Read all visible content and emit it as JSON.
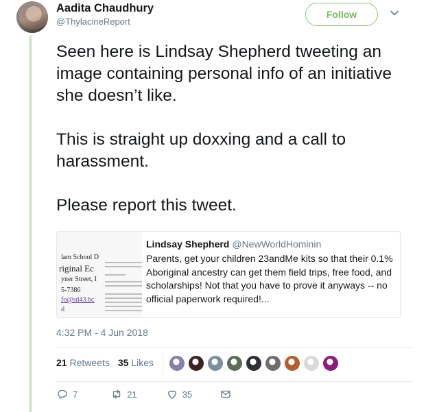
{
  "author": {
    "name": "Aadita Chaudhury",
    "handle": "@ThylacineReport"
  },
  "follow_label": "Follow",
  "tweet": {
    "paragraphs": [
      "Seen here is Lindsay Shepherd tweeting an image containing personal info of an initiative she doesn’t like.",
      "This is  straight up doxxing and a call to harassment.",
      "Please report this tweet."
    ]
  },
  "quoted": {
    "name": "Lindsay Shepherd",
    "handle": "@NewWorldHominin",
    "text": "Parents, get your children 23andMe kits so that their 0.1% Aboriginal ancestry can get them field trips, free food, and scholarships! Not that you have to prove it anyways -- no official paperwork required!...",
    "thumb_lines": [
      "lam School D",
      "riginal Ec",
      "yner Street, I",
      "5-7386",
      "fo@sd43.bc",
      "d"
    ]
  },
  "timestamp": "4:32 PM - 4 Jun 2018",
  "stats": {
    "retweets_count": "21",
    "retweets_label": "Retweets",
    "likes_count": "35",
    "likes_label": "Likes"
  },
  "liker_colors": [
    "#8a7fa8",
    "#3a2320",
    "#7c8f9a",
    "#5f6b5a",
    "#2f3136",
    "#6e6e6e",
    "#b0602f",
    "#d9d9d9",
    "#8d1d7a"
  ],
  "actions": {
    "replies": "7",
    "retweets": "21",
    "likes": "35"
  },
  "colors": {
    "accent_green": "#7cb75f",
    "rail_green": "#c7e3b7",
    "secondary_text": "#657786",
    "link_purple": "#6b3fa0"
  }
}
